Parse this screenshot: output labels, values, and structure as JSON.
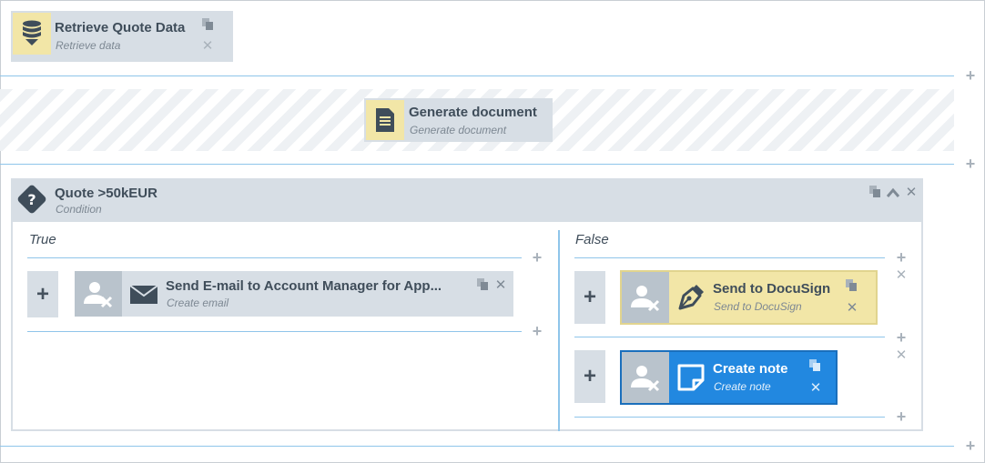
{
  "steps": {
    "retrieve": {
      "title": "Retrieve Quote Data",
      "subtitle": "Retrieve data",
      "icon": "database-icon"
    },
    "generate": {
      "title": "Generate document",
      "subtitle": "Generate document",
      "icon": "document-icon"
    },
    "condition": {
      "title": "Quote >50kEUR",
      "subtitle": "Condition",
      "icon": "question-icon",
      "branches": {
        "true": {
          "label": "True",
          "add_label": "+",
          "email": {
            "title": "Send E-mail to Account Manager for App...",
            "subtitle": "Create email",
            "icon": "envelope-icon"
          }
        },
        "false": {
          "label": "False",
          "add_label": "+",
          "docusign": {
            "title": "Send to DocuSign",
            "subtitle": "Send to DocuSign",
            "icon": "pen-nib-icon"
          },
          "note": {
            "title": "Create note",
            "subtitle": "Create note",
            "icon": "note-icon"
          }
        }
      }
    }
  },
  "symbols": {
    "plus": "+",
    "close": "✕"
  },
  "colors": {
    "accent": "#2288e0",
    "highlight": "#f2e6a7",
    "card": "#d7dee5",
    "connector": "#8fc5ea"
  }
}
